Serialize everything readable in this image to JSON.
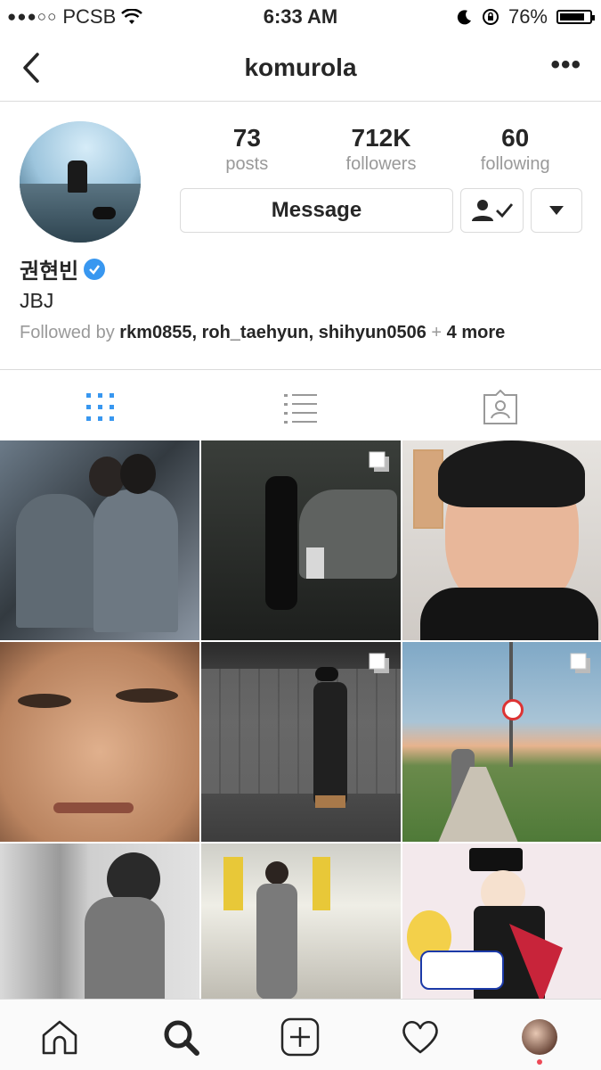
{
  "status_bar": {
    "carrier": "PCSB",
    "time": "6:33 AM",
    "battery": "76%",
    "battery_level": 0.76
  },
  "nav": {
    "title": "komurola"
  },
  "stats": {
    "posts_count": "73",
    "posts_label": "posts",
    "followers_count": "712K",
    "followers_label": "followers",
    "following_count": "60",
    "following_label": "following"
  },
  "actions": {
    "message_label": "Message"
  },
  "profile": {
    "name": "권현빈",
    "bio": "JBJ",
    "followed_prefix": "Followed by ",
    "followed_users": "rkm0855, roh_taehyun, shihyun0506",
    "followed_more_sep": " + ",
    "followed_more": "4 more"
  },
  "tabs": [
    {
      "name": "grid",
      "icon": "grid-icon",
      "active": true
    },
    {
      "name": "list",
      "icon": "list-icon",
      "active": false
    },
    {
      "name": "tagged",
      "icon": "tagged-photo-icon",
      "active": false
    }
  ],
  "grid": [
    {
      "desc": "two friends selfie in suits",
      "multi": false
    },
    {
      "desc": "man walking in dark parking lot",
      "multi": true
    },
    {
      "desc": "close-up face with beanie",
      "multi": false
    },
    {
      "desc": "close-up face",
      "multi": false
    },
    {
      "desc": "man in bucket hat in tunnel",
      "multi": true
    },
    {
      "desc": "man on riverside path at sunset",
      "multi": true
    },
    {
      "desc": "mirror selfie",
      "multi": false
    },
    {
      "desc": "man in parking garage",
      "multi": false
    },
    {
      "desc": "anime illustration",
      "multi": false
    }
  ],
  "colors": {
    "accent": "#3897f0",
    "border": "#dbdbdb",
    "muted": "#999999",
    "notification": "#ed4956"
  }
}
